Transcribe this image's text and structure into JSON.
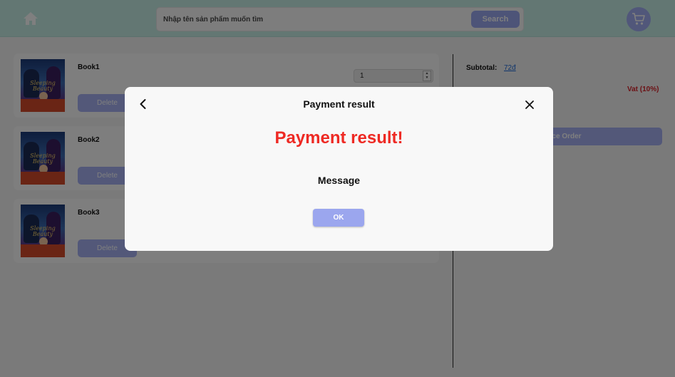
{
  "header": {
    "home_icon": "home-icon",
    "search_placeholder": "Nhập tên sản phẩm muốn tìm",
    "search_label": "Search",
    "cart_icon": "cart-icon"
  },
  "cart": {
    "items": [
      {
        "name": "Book1",
        "quantity": "1",
        "delete_label": "Delete",
        "cover_title": "Sleeping Beauty"
      },
      {
        "name": "Book2",
        "delete_label": "Delete",
        "cover_title": "Sleeping Beauty"
      },
      {
        "name": "Book3",
        "delete_label": "Delete",
        "cover_title": "Sleeping Beauty"
      }
    ]
  },
  "summary": {
    "subtotal_label": "Subtotal:",
    "subtotal_value": "72đ",
    "vat_label": "Vat (10%)",
    "place_order_label": "Place Order"
  },
  "modal": {
    "title": "Payment result",
    "heading": "Payment result!",
    "message": "Message",
    "ok_label": "OK",
    "back_icon": "back-arrow-icon",
    "close_icon": "close-icon"
  },
  "colors": {
    "header_bg": "#c6efe7",
    "accent": "#a6b1f2",
    "error_red": "#ee2a24",
    "link_blue": "#1f6ad8"
  }
}
